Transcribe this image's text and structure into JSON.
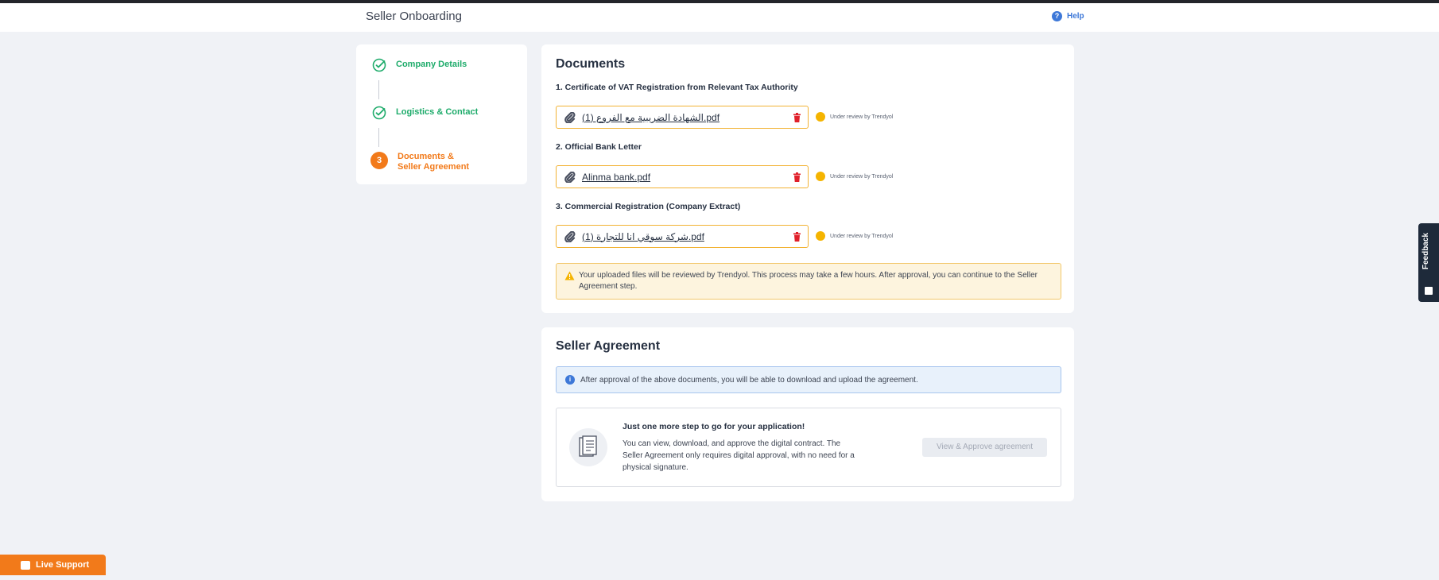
{
  "header": {
    "title": "Seller Onboarding",
    "help_label": "Help"
  },
  "stepper": {
    "steps": [
      {
        "label": "Company Details",
        "state": "complete"
      },
      {
        "label": "Logistics & Contact",
        "state": "complete"
      },
      {
        "number": "3",
        "label": "Documents & Seller Agreement",
        "state": "active"
      }
    ]
  },
  "documents": {
    "title": "Documents",
    "items": [
      {
        "label": "1. Certificate of VAT Registration from Relevant Tax Authority",
        "file": "الشهادة الضريبية مع الفروع (1).pdf",
        "status": "Under review by Trendyol"
      },
      {
        "label": "2. Official Bank Letter",
        "file": "Alinma bank.pdf",
        "status": "Under review by Trendyol"
      },
      {
        "label": "3. Commercial Registration (Company Extract)",
        "file": "شركة سوقي انا للتجارة (1).pdf",
        "status": "Under review by Trendyol"
      }
    ],
    "notice": "Your uploaded files will be reviewed by Trendyol. This process may take a few hours. After approval, you can continue to the Seller Agreement step."
  },
  "agreement": {
    "title": "Seller Agreement",
    "info": "After approval of the above documents, you will be able to download and upload the agreement.",
    "heading": "Just one more step to go for your application!",
    "description": "You can view, download, and approve the digital contract. The Seller Agreement only requires digital approval, with no need for a physical signature.",
    "button_label": "View & Approve agreement"
  },
  "feedback_label": "Feedback",
  "live_support_label": "Live Support",
  "colors": {
    "brand_orange": "#f27a1a",
    "success_green": "#1dab6a",
    "status_yellow": "#f5b400",
    "info_blue": "#3d78d8"
  }
}
